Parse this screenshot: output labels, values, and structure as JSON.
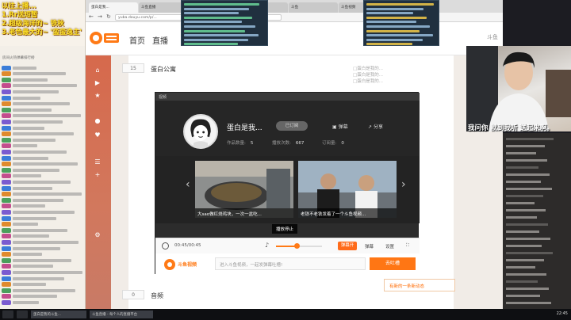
{
  "overlay": {
    "lines": [
      "以往上播...",
      "1.Rr送短暂",
      "2.超级海洋的~ 铁秋",
      "3.老色最大的~ '蛮蛮逸主'"
    ]
  },
  "chat": {
    "header": "房间火热弹幕排行榜",
    "rows": 40
  },
  "browser": {
    "tabs": [
      "蛋白是我...",
      "斗鱼直播",
      "蛋白公寓",
      "斗鱼",
      "斗鱼",
      "斗鱼视频",
      "新标签页"
    ],
    "url": "yuba.douyu.com/p/...",
    "nav": [
      "首页",
      "直播"
    ],
    "search_hint": "斗鱼"
  },
  "section": {
    "number": "15",
    "title": "蛋白公寓",
    "right_links": [
      "蛋白是我的...",
      "蛋白是我的...",
      "蛋白是我的..."
    ]
  },
  "video": {
    "top_label": "视频",
    "author_name": "蛋白是我...",
    "follow_label": "已订阅",
    "action_barrage": "弹幕",
    "action_share": "分享",
    "stats": [
      {
        "label": "作品数量:",
        "value": "5"
      },
      {
        "label": "播放次数:",
        "value": "667"
      },
      {
        "label": "订阅量:",
        "value": "0"
      }
    ],
    "thumbs": [
      {
        "caption": "大sao做红烧鸡块，一次一盆吃..."
      },
      {
        "caption": "老铁不老铁发着了一个斗鱼视频..."
      }
    ],
    "pause_tip": "播放停止",
    "time": "00:45/00:45",
    "volume": 0.45,
    "barrage_button": "弹幕开",
    "ctrl_right": [
      "弹幕",
      "设置"
    ],
    "comment_placeholder": "进入斗鱼视频，一起发弹幕吐槽!",
    "send_button": "去吐槽",
    "brand_logo_text": "斗鱼视频"
  },
  "section2": {
    "number": "0",
    "title": "音频"
  },
  "notify": "有新的一条新动态",
  "cam_text": "我问你 就到我听 送起来啊。",
  "taskbar": {
    "apps": [
      "蛋白是我的斗鱼...",
      "斗鱼直播 - 每个人的直播平台"
    ],
    "clock": "22:45"
  },
  "colors": {
    "accent": "#ff7614",
    "sidebar": "#d6694c",
    "overlay_text": "#ffe22a"
  }
}
